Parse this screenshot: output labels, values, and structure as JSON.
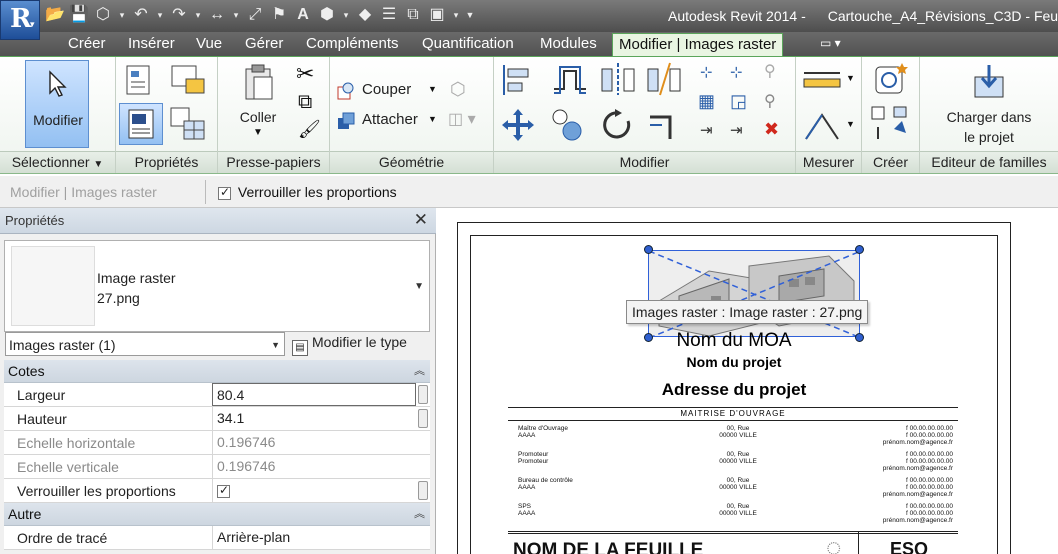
{
  "titlebar": {
    "app": "Autodesk Revit 2014 -",
    "document": "Cartouche_A4_Révisions_C3D - Feu"
  },
  "tabs": [
    {
      "label": "Créer"
    },
    {
      "label": "Insérer"
    },
    {
      "label": "Vue"
    },
    {
      "label": "Gérer"
    },
    {
      "label": "Compléments"
    },
    {
      "label": "Quantification"
    },
    {
      "label": "Modules"
    },
    {
      "label": "Modifier | Images raster"
    }
  ],
  "ribbon": {
    "select_panel": {
      "button": "Modifier",
      "label": "Sélectionner"
    },
    "properties_panel": {
      "label": "Propriétés"
    },
    "clipboard_panel": {
      "paste": "Coller",
      "label": "Presse-papiers"
    },
    "geometry_panel": {
      "cut": "Couper",
      "join": "Attacher",
      "label": "Géométrie"
    },
    "modify_panel": {
      "label": "Modifier"
    },
    "measure_panel": {
      "label": "Mesurer"
    },
    "create_panel": {
      "label": "Créer"
    },
    "family_panel": {
      "load_line1": "Charger dans",
      "load_line2": "le projet",
      "label": "Editeur de familles"
    }
  },
  "options_bar": {
    "context": "Modifier | Images raster",
    "lock_label": "Verrouiller les proportions"
  },
  "properties": {
    "title": "Propriétés",
    "type_line1": "Image raster",
    "type_line2": "27.png",
    "filter": "Images raster (1)",
    "edit_type": "Modifier le type",
    "group_dimensions": "Cotes",
    "rows": [
      {
        "label": "Largeur",
        "value": "80.4"
      },
      {
        "label": "Hauteur",
        "value": "34.1"
      },
      {
        "label": "Echelle horizontale",
        "value": "0.196746"
      },
      {
        "label": "Echelle verticale",
        "value": "0.196746"
      },
      {
        "label": "Verrouiller les proportions",
        "value": ""
      }
    ],
    "group_other": "Autre",
    "draw_order_label": "Ordre de tracé",
    "draw_order_value": "Arrière-plan"
  },
  "sheet": {
    "tooltip": "Images raster : Image raster : 27.png",
    "moa": "Nom du MOA",
    "project_name": "Nom du projet",
    "project_address": "Adresse du projet",
    "section_header": "MAITRISE D'OUVRAGE",
    "entries": [
      {
        "role": "Maître d'Ouvrage",
        "role2": "AAAA",
        "addr1": "00, Rue",
        "addr2": "00000 VILLE",
        "phone1": "f 00.00.00.00.00",
        "phone2": "f 00.00.00.00.00",
        "mail": "prénom.nom@agence.fr"
      },
      {
        "role": "Promoteur",
        "role2": "Promoteur",
        "addr1": "00, Rue",
        "addr2": "00000 VILLE",
        "phone1": "f 00.00.00.00.00",
        "phone2": "f 00.00.00.00.00",
        "mail": "prénom.nom@agence.fr"
      },
      {
        "role": "Bureau de contrôle",
        "role2": "AAAA",
        "addr1": "00, Rue",
        "addr2": "00000 VILLE",
        "phone1": "f 00.00.00.00.00",
        "phone2": "f 00.00.00.00.00",
        "mail": "prénom.nom@agence.fr"
      },
      {
        "role": "SPS",
        "role2": "AAAA",
        "addr1": "00, Rue",
        "addr2": "00000 VILLE",
        "phone1": "f 00.00.00.00.00",
        "phone2": "f 00.00.00.00.00",
        "mail": "prénom.nom@agence.fr"
      }
    ],
    "sheet_name": "NOM DE LA FEUILLE",
    "phase": "ESQ"
  }
}
